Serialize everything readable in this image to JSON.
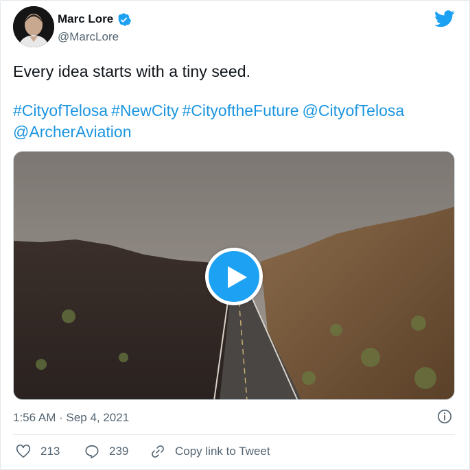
{
  "author": {
    "name": "Marc Lore",
    "handle": "@MarcLore",
    "verified": true
  },
  "tweet": {
    "text": "Every idea starts with a tiny seed.",
    "links": [
      "#CityofTelosa",
      "#NewCity",
      "#CityoftheFuture",
      "@CityofTelosa",
      "@ArcherAviation"
    ]
  },
  "media": {
    "type": "video",
    "play_icon": "play-icon"
  },
  "meta": {
    "timestamp": "1:56 AM · Sep 4, 2021"
  },
  "actions": {
    "likes": "213",
    "replies": "239",
    "copy_link": "Copy link to Tweet"
  },
  "colors": {
    "brand": "#1da1f2",
    "link": "#1b95e0",
    "muted": "#536471"
  }
}
